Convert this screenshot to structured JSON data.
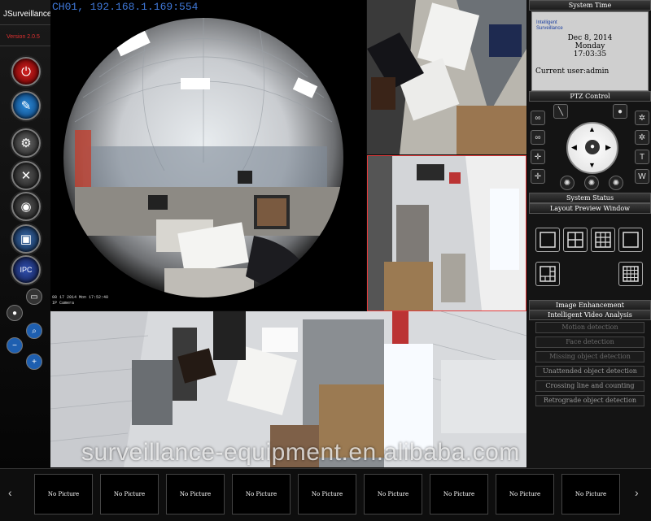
{
  "app": {
    "title": "JSurveillance",
    "version": "Version 2.0.5"
  },
  "video": {
    "channel_label": "CH01, 192.168.1.169:554",
    "osd_timestamp": "08 17 2014 Mon 17:52:40",
    "osd_camera": "IP Camera",
    "watermark": "surveillance-equipment.en.alibaba.com"
  },
  "sidebar": {
    "buttons": [
      {
        "icon": "power-icon",
        "glyph": "⏻"
      },
      {
        "icon": "edit-icon",
        "glyph": "✎"
      },
      {
        "icon": "gears-icon",
        "glyph": "⚙"
      },
      {
        "icon": "tools-icon",
        "glyph": "✕"
      },
      {
        "icon": "camera-icon",
        "glyph": "◉"
      },
      {
        "icon": "recorder-icon",
        "glyph": "▣"
      },
      {
        "icon": "ipc-icon",
        "glyph": "IPC"
      }
    ],
    "small_buttons": [
      {
        "icon": "monitor-icon",
        "glyph": "▭"
      },
      {
        "icon": "disk-icon",
        "glyph": "●"
      },
      {
        "icon": "zoom-out-icon",
        "glyph": "−"
      },
      {
        "icon": "zoom-in-icon",
        "glyph": "+"
      },
      {
        "icon": "search-icon",
        "glyph": "⌕"
      },
      {
        "icon": "add-icon",
        "glyph": "+"
      }
    ]
  },
  "panel": {
    "system_time_header": "System Time",
    "logo_line1": "Intelligent",
    "logo_line2": "Surveillance",
    "date": "Dec 8, 2014",
    "weekday": "Monday",
    "time": "17:03:35",
    "current_user": "Current user:admin",
    "ptz_header": "PTZ Control",
    "status_header": "System Status",
    "layout_header": "Layout Preview Window",
    "enhancement_header": "Image Enhancement",
    "iva_header": "Intelligent Video Analysis",
    "ptz_right_labels": [
      "T",
      "W"
    ],
    "iva_buttons": [
      "Motion detection",
      "Face detection",
      "Missing object detection",
      "Unattended object detection",
      "Crossing line and counting",
      "Retrograde object detection"
    ]
  },
  "thumbnails": [
    "No Picture",
    "No Picture",
    "No Picture",
    "No Picture",
    "No Picture",
    "No Picture",
    "No Picture",
    "No Picture",
    "No Picture"
  ],
  "colors": {
    "accent_blue": "#3f78d8",
    "version_red": "#e03030",
    "highlight_border": "#e33b3b"
  }
}
